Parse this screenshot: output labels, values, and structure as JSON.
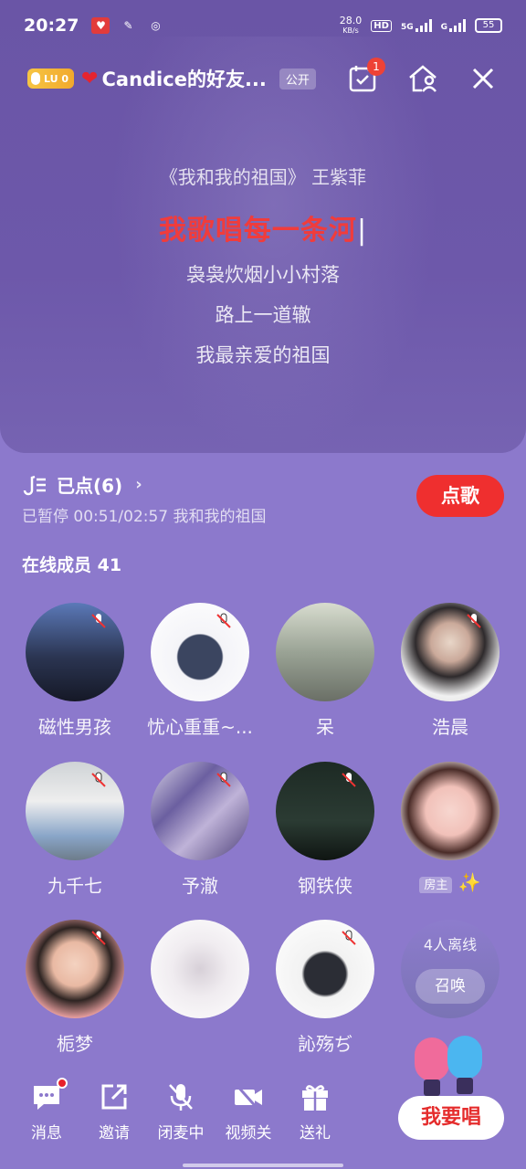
{
  "status_bar": {
    "time": "20:27",
    "net_speed": "28.0",
    "net_unit": "KB/s",
    "hd": "HD",
    "net_5g": "5G",
    "net_g": "G",
    "battery": "55"
  },
  "header": {
    "level": "LU 0",
    "title": "Candice的好友...",
    "visibility": "公开",
    "task_badge": "1"
  },
  "lyrics": {
    "song_title": "《我和我的祖国》 王紫菲",
    "current": "我歌唱每一条河",
    "lines": [
      "袅袅炊烟小小村落",
      "路上一道辙",
      "我最亲爱的祖国"
    ]
  },
  "playing": {
    "queue_label": "已点(6)",
    "status_text": "已暂停  00:51/02:57  我和我的祖国",
    "order_button": "点歌"
  },
  "online": {
    "title": "在线成员 41"
  },
  "members": [
    {
      "name": "磁性男孩"
    },
    {
      "name": "忧心重重~..."
    },
    {
      "name": "呆"
    },
    {
      "name": "浩晨"
    },
    {
      "name": "九千七"
    },
    {
      "name": "予澈"
    },
    {
      "name": "钢铁侠"
    },
    {
      "name": "✨",
      "host_tag": "房主"
    },
    {
      "name": "栀梦"
    },
    {
      "name": ""
    },
    {
      "name": "訫殇ぢ"
    }
  ],
  "offline": {
    "text": "4人离线",
    "summon_button": "召唤"
  },
  "bottom_bar": {
    "message": "消息",
    "invite": "邀请",
    "mic_off": "闭麦中",
    "video_off": "视频关",
    "gift": "送礼",
    "sing_button": "我要唱"
  },
  "colors": {
    "background": "#8c79cc",
    "accent_red": "#ef2f2f"
  }
}
